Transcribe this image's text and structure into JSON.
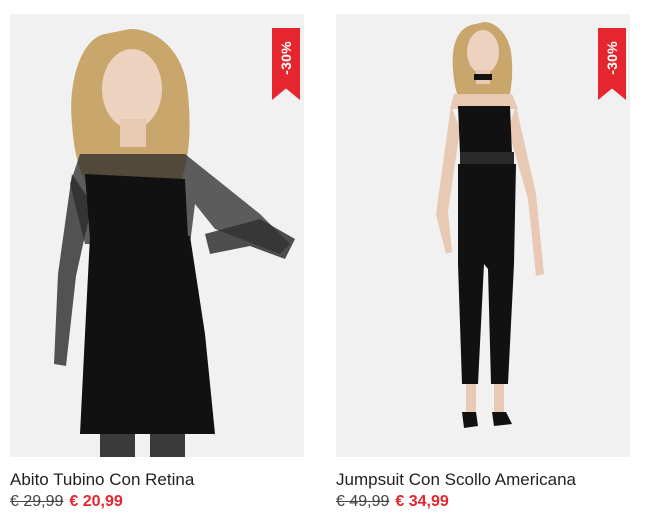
{
  "products": [
    {
      "name": "Abito Tubino Con Retina",
      "badge": "-30%",
      "old_price": "€ 29,99",
      "new_price": "€ 20,99"
    },
    {
      "name": "Jumpsuit Con Scollo Americana",
      "badge": "-30%",
      "old_price": "€ 49,99",
      "new_price": "€ 34,99"
    }
  ],
  "colors": {
    "accent": "#e6262e",
    "photo_bg": "#f1f1f1",
    "garment": "#111111"
  }
}
